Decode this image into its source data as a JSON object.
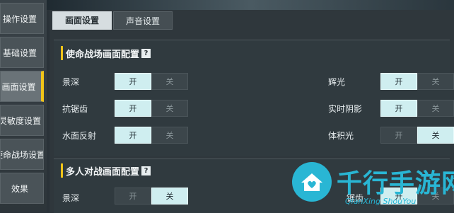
{
  "sidebar": {
    "items": [
      {
        "label": "操作设置"
      },
      {
        "label": "基础设置"
      },
      {
        "label": "画面设置"
      },
      {
        "label": "灵敏度设置"
      },
      {
        "label": "使命战场设置"
      },
      {
        "label": "效果"
      }
    ],
    "active_index": 2
  },
  "tabs": [
    {
      "label": "画面设置",
      "active": true
    },
    {
      "label": "声音设置",
      "active": false
    }
  ],
  "section1": {
    "title": "使命战场画面配置",
    "help": "?",
    "rows": [
      {
        "label": "景深",
        "on": "开",
        "off": "关",
        "selected": "开"
      },
      {
        "label": "抗锯齿",
        "on": "开",
        "off": "关",
        "selected": "开"
      },
      {
        "label": "水面反射",
        "on": "开",
        "off": "关",
        "selected": "开"
      },
      {
        "label": "辉光",
        "on": "开",
        "off": "关",
        "selected": "开"
      },
      {
        "label": "实时阴影",
        "on": "开",
        "off": "关",
        "selected": "开"
      },
      {
        "label": "体积光",
        "on": "开",
        "off": "关",
        "selected": "关"
      }
    ]
  },
  "section2": {
    "title": "多人对战画面配置",
    "help": "?",
    "rows": [
      {
        "label": "景深",
        "on": "开",
        "off": "关",
        "selected": "关"
      },
      {
        "label": "锯齿",
        "on": "开",
        "off": "关",
        "selected": "开"
      }
    ]
  },
  "watermark": {
    "text": "千行手游网",
    "sub": "QianXing ShouYou",
    "color": "#29b6d4"
  },
  "colors": {
    "accent": "#f0c419",
    "toggle_on": "#cfeef0",
    "toggle_off": "#3c464b"
  }
}
